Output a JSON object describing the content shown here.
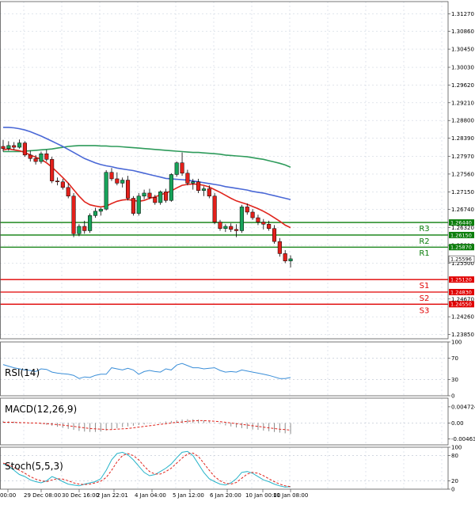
{
  "chart_data": {
    "type": "candlestick",
    "title": "",
    "grid": true,
    "x_labels": [
      "00:00",
      "29 Dec 08:00",
      "30 Dec 16:00",
      "2 Jan 22:01",
      "4 Jan 04:00",
      "5 Jan 12:00",
      "6 Jan 20:00",
      "10 Jan 00:00",
      "11 Jan 08:00"
    ],
    "price_panel": {
      "ylim": [
        1.2375,
        1.3155
      ],
      "ticks": [
        "1.31270",
        "1.30860",
        "1.30450",
        "1.30030",
        "1.29620",
        "1.29210",
        "1.28800",
        "1.28390",
        "1.27970",
        "1.27560",
        "1.27150",
        "1.26740",
        "1.26320",
        "1.25910",
        "1.25500",
        "1.24670",
        "1.24260",
        "1.23850"
      ],
      "ohlc": [
        [
          1.282,
          1.2835,
          1.2808,
          1.2815
        ],
        [
          1.2815,
          1.2832,
          1.281,
          1.2822
        ],
        [
          1.2822,
          1.283,
          1.2812,
          1.2818
        ],
        [
          1.2818,
          1.2836,
          1.2815,
          1.2828
        ],
        [
          1.2828,
          1.2832,
          1.2796,
          1.28
        ],
        [
          1.28,
          1.281,
          1.2785,
          1.2792
        ],
        [
          1.2792,
          1.28,
          1.2778,
          1.2785
        ],
        [
          1.2785,
          1.2808,
          1.278,
          1.2803
        ],
        [
          1.2803,
          1.2812,
          1.2785,
          1.279
        ],
        [
          1.279,
          1.2796,
          1.2735,
          1.274
        ],
        [
          1.274,
          1.2748,
          1.273,
          1.2738
        ],
        [
          1.2738,
          1.2745,
          1.272,
          1.2725
        ],
        [
          1.2725,
          1.2735,
          1.27,
          1.2705
        ],
        [
          1.2705,
          1.2712,
          1.261,
          1.2618
        ],
        [
          1.2618,
          1.264,
          1.2612,
          1.2635
        ],
        [
          1.2635,
          1.2648,
          1.2618,
          1.2625
        ],
        [
          1.2625,
          1.2665,
          1.262,
          1.266
        ],
        [
          1.266,
          1.2678,
          1.2655,
          1.267
        ],
        [
          1.267,
          1.2678,
          1.266,
          1.2675
        ],
        [
          1.2675,
          1.2765,
          1.2672,
          1.276
        ],
        [
          1.276,
          1.277,
          1.274,
          1.2745
        ],
        [
          1.2745,
          1.276,
          1.273,
          1.2735
        ],
        [
          1.2735,
          1.2748,
          1.2725,
          1.2742
        ],
        [
          1.2742,
          1.2752,
          1.2695,
          1.27
        ],
        [
          1.27,
          1.2705,
          1.266,
          1.2665
        ],
        [
          1.2665,
          1.2712,
          1.266,
          1.2705
        ],
        [
          1.2705,
          1.272,
          1.2698,
          1.2712
        ],
        [
          1.2712,
          1.2722,
          1.2698,
          1.2702
        ],
        [
          1.2702,
          1.2708,
          1.2685,
          1.269
        ],
        [
          1.269,
          1.2718,
          1.2685,
          1.2715
        ],
        [
          1.2715,
          1.2722,
          1.269,
          1.2695
        ],
        [
          1.2695,
          1.2758,
          1.2692,
          1.2755
        ],
        [
          1.2755,
          1.2785,
          1.275,
          1.2782
        ],
        [
          1.2782,
          1.2806,
          1.2752,
          1.2758
        ],
        [
          1.2758,
          1.2766,
          1.273,
          1.2735
        ],
        [
          1.2735,
          1.2745,
          1.272,
          1.2738
        ],
        [
          1.2738,
          1.2745,
          1.2712,
          1.2718
        ],
        [
          1.2718,
          1.2728,
          1.2705,
          1.2722
        ],
        [
          1.2722,
          1.273,
          1.27,
          1.2705
        ],
        [
          1.2705,
          1.2712,
          1.264,
          1.2645
        ],
        [
          1.2645,
          1.265,
          1.2625,
          1.263
        ],
        [
          1.263,
          1.264,
          1.2622,
          1.2635
        ],
        [
          1.2635,
          1.2642,
          1.2622,
          1.2628
        ],
        [
          1.2628,
          1.264,
          1.261,
          1.2625
        ],
        [
          1.2625,
          1.2685,
          1.262,
          1.268
        ],
        [
          1.268,
          1.2688,
          1.2662,
          1.2668
        ],
        [
          1.2668,
          1.2675,
          1.265,
          1.2655
        ],
        [
          1.2655,
          1.2662,
          1.2638,
          1.2645
        ],
        [
          1.2645,
          1.2652,
          1.2628,
          1.264
        ],
        [
          1.264,
          1.2648,
          1.2625,
          1.263
        ],
        [
          1.263,
          1.2638,
          1.2595,
          1.26
        ],
        [
          1.26,
          1.2608,
          1.2565,
          1.2572
        ],
        [
          1.2572,
          1.258,
          1.255,
          1.2555
        ],
        [
          1.2555,
          1.2568,
          1.254,
          1.256
        ]
      ],
      "ma_fast": [
        1.2812,
        1.2814,
        1.2812,
        1.281,
        1.2806,
        1.28,
        1.2795,
        1.279,
        1.2782,
        1.2772,
        1.276,
        1.2748,
        1.2735,
        1.272,
        1.2705,
        1.2692,
        1.2685,
        1.2682,
        1.268,
        1.2682,
        1.2688,
        1.2693,
        1.2696,
        1.2697,
        1.2695,
        1.2693,
        1.2695,
        1.27,
        1.2703,
        1.2708,
        1.2712,
        1.2717,
        1.2724,
        1.273,
        1.2732,
        1.2733,
        1.2732,
        1.273,
        1.2726,
        1.272,
        1.2714,
        1.2707,
        1.27,
        1.2694,
        1.269,
        1.2686,
        1.2681,
        1.2676,
        1.267,
        1.2663,
        1.2655,
        1.2647,
        1.2638,
        1.2632
      ],
      "ma_mid": [
        1.2864,
        1.2864,
        1.2863,
        1.2861,
        1.2858,
        1.2854,
        1.2849,
        1.2844,
        1.2838,
        1.2832,
        1.2826,
        1.282,
        1.2813,
        1.2806,
        1.2799,
        1.2792,
        1.2787,
        1.2782,
        1.2778,
        1.2775,
        1.2773,
        1.277,
        1.2768,
        1.2766,
        1.2764,
        1.2761,
        1.2758,
        1.2755,
        1.2752,
        1.2749,
        1.2746,
        1.2745,
        1.2744,
        1.2743,
        1.2742,
        1.274,
        1.2738,
        1.2736,
        1.2734,
        1.2732,
        1.273,
        1.2727,
        1.2725,
        1.2723,
        1.2721,
        1.2719,
        1.2716,
        1.2714,
        1.2712,
        1.2709,
        1.2706,
        1.2703,
        1.27,
        1.2697
      ],
      "ma_slow": [
        1.2808,
        1.2808,
        1.2808,
        1.2808,
        1.2809,
        1.281,
        1.2811,
        1.2812,
        1.2813,
        1.2814,
        1.2816,
        1.2818,
        1.282,
        1.2821,
        1.2822,
        1.2822,
        1.2822,
        1.2822,
        1.2821,
        1.2821,
        1.282,
        1.282,
        1.2819,
        1.2818,
        1.2817,
        1.2816,
        1.2815,
        1.2814,
        1.2813,
        1.2812,
        1.2811,
        1.281,
        1.2809,
        1.2808,
        1.2807,
        1.2806,
        1.2806,
        1.2805,
        1.2804,
        1.2803,
        1.2802,
        1.28,
        1.2799,
        1.2798,
        1.2797,
        1.2796,
        1.2794,
        1.2792,
        1.279,
        1.2787,
        1.2784,
        1.2781,
        1.2777,
        1.2772
      ],
      "levels": [
        {
          "name": "R3",
          "value": 1.2644,
          "tag": "1.26440",
          "color": "#0a7d0a"
        },
        {
          "name": "R2",
          "value": 1.2615,
          "tag": "1.26150",
          "color": "#0a7d0a"
        },
        {
          "name": "R1",
          "value": 1.2587,
          "tag": "1.25870",
          "color": "#0a7d0a"
        },
        {
          "name": "S1",
          "value": 1.2512,
          "tag": "1.25120",
          "color": "#e00000"
        },
        {
          "name": "S2",
          "value": 1.2483,
          "tag": "1.24830",
          "color": "#e00000"
        },
        {
          "name": "S3",
          "value": 1.2455,
          "tag": "1.24550",
          "color": "#e00000"
        }
      ],
      "current_price": {
        "value": 1.25596,
        "tag": "1.25596"
      }
    },
    "rsi_panel": {
      "label": "RSI(14)",
      "ylim": [
        0,
        100
      ],
      "ticks": [
        "100",
        "70",
        "30",
        "0"
      ],
      "values": [
        58,
        55,
        52,
        50,
        48,
        47,
        45,
        50,
        49,
        44,
        42,
        41,
        40,
        38,
        32,
        35,
        34,
        38,
        40,
        40,
        52,
        50,
        48,
        51,
        48,
        40,
        45,
        47,
        45,
        44,
        50,
        48,
        57,
        60,
        56,
        52,
        52,
        50,
        51,
        52,
        47,
        44,
        45,
        44,
        48,
        46,
        44,
        42,
        40,
        38,
        35,
        32,
        32,
        34
      ]
    },
    "macd_panel": {
      "label": "MACD(12,26,9)",
      "ylim": [
        -0.00636,
        0.00724
      ],
      "ticks": [
        "0.004724",
        "0.00",
        "-0.004636"
      ],
      "histogram": [
        0.0006,
        0.0005,
        0.0004,
        0.0003,
        0.0002,
        0.0001,
        -0.0001,
        -0.0003,
        -0.0005,
        -0.0008,
        -0.0011,
        -0.0014,
        -0.0017,
        -0.002,
        -0.0023,
        -0.0025,
        -0.0026,
        -0.0026,
        -0.0025,
        -0.0022,
        -0.0019,
        -0.0015,
        -0.0012,
        -0.001,
        -0.0008,
        -0.0006,
        -0.0004,
        -0.0002,
        0.0,
        0.0002,
        0.0004,
        0.0006,
        0.0008,
        0.001,
        0.0011,
        0.0011,
        0.001,
        0.0008,
        0.0005,
        0.0001,
        -0.0003,
        -0.0007,
        -0.001,
        -0.0013,
        -0.0015,
        -0.0017,
        -0.0019,
        -0.002,
        -0.0022,
        -0.0024,
        -0.0026,
        -0.0028,
        -0.003,
        -0.0032
      ],
      "signal": [
        0.0002,
        0.0002,
        0.0002,
        0.0001,
        0.0001,
        0.0,
        0.0,
        -0.0001,
        -0.0002,
        -0.0003,
        -0.0005,
        -0.0006,
        -0.0008,
        -0.001,
        -0.0012,
        -0.0014,
        -0.0016,
        -0.0017,
        -0.0018,
        -0.0019,
        -0.0019,
        -0.0018,
        -0.0017,
        -0.0016,
        -0.0014,
        -0.0012,
        -0.001,
        -0.0008,
        -0.0006,
        -0.0004,
        -0.0002,
        0.0,
        0.0002,
        0.0003,
        0.0005,
        0.0006,
        0.0007,
        0.0007,
        0.0006,
        0.0005,
        0.0004,
        0.0002,
        0.0,
        -0.0002,
        -0.0004,
        -0.0006,
        -0.0008,
        -0.001,
        -0.0012,
        -0.0014,
        -0.0016,
        -0.0018,
        -0.0019,
        -0.0021
      ]
    },
    "stoch_panel": {
      "label": "Stoch(5,5,3)",
      "ylim": [
        0,
        100
      ],
      "ticks": [
        "100",
        "80",
        "20",
        "0"
      ],
      "k": [
        60,
        55,
        45,
        35,
        30,
        22,
        18,
        15,
        20,
        30,
        25,
        18,
        12,
        10,
        8,
        12,
        15,
        18,
        25,
        45,
        70,
        85,
        88,
        82,
        70,
        55,
        40,
        32,
        35,
        42,
        50,
        60,
        75,
        88,
        90,
        80,
        60,
        40,
        25,
        18,
        12,
        10,
        15,
        25,
        40,
        42,
        38,
        30,
        22,
        18,
        12,
        8,
        5,
        6
      ],
      "d": [
        62,
        58,
        52,
        45,
        38,
        30,
        24,
        20,
        18,
        22,
        25,
        24,
        20,
        15,
        12,
        11,
        12,
        15,
        19,
        28,
        45,
        65,
        80,
        85,
        80,
        70,
        55,
        42,
        36,
        36,
        42,
        50,
        62,
        74,
        84,
        86,
        78,
        62,
        45,
        30,
        20,
        14,
        12,
        16,
        26,
        36,
        40,
        38,
        32,
        25,
        18,
        12,
        8,
        6
      ]
    }
  }
}
